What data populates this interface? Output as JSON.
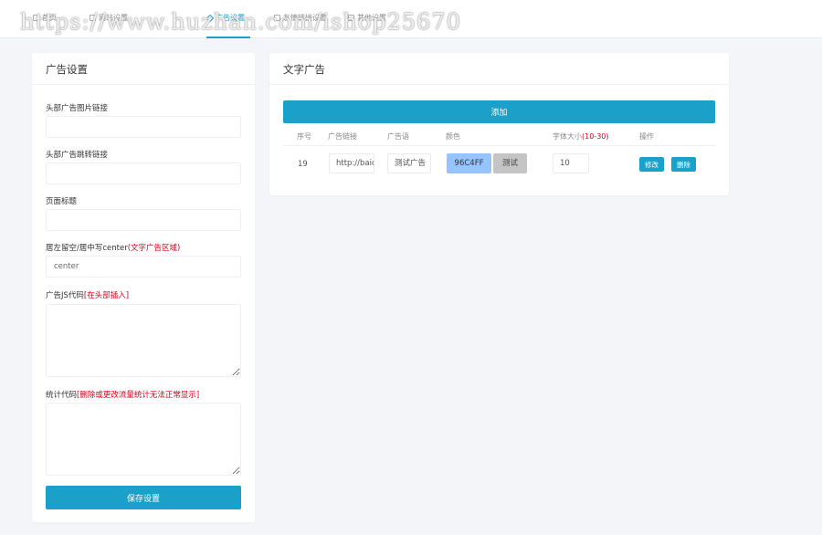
{
  "watermark": "https://www.huzhan.com/ishop25670",
  "nav": {
    "items": [
      {
        "label": "首页"
      },
      {
        "label": "网站设置"
      },
      {
        "label": "广告设置"
      },
      {
        "label": "友情链接设置"
      },
      {
        "label": "其他设置"
      }
    ],
    "active_index": 2
  },
  "ad_settings": {
    "title": "广告设置",
    "header_image_label": "头部广告图片链接",
    "header_image_value": "",
    "header_link_label": "头部广告跳转链接",
    "header_link_value": "",
    "page_title_label": "页面标题",
    "page_title_value": "",
    "align_label": "居左留空/居中写center",
    "align_note": "(文字广告区域)",
    "align_value": "center",
    "js_label": "广告JS代码",
    "js_note": "[在头部插入]",
    "stats_label": "统计代码",
    "stats_note": "[删除或更改流量统计无法正常显示]",
    "save_label": "保存设置"
  },
  "text_ads": {
    "title": "文字广告",
    "add_label": "添加",
    "columns": {
      "id": "序号",
      "link": "广告链接",
      "slogan": "广告语",
      "color": "颜色",
      "font_size": "字体大小",
      "font_size_note": "(10-30)",
      "actions": "操作"
    },
    "rows": [
      {
        "id": "19",
        "link": "http://baidu.com",
        "slogan": "测试广告",
        "color": "96C4FF",
        "color_hex": "#96C4FF",
        "preview": "测试",
        "font_size": "10",
        "edit_label": "修改",
        "delete_label": "删除"
      }
    ]
  },
  "colors": {
    "accent": "#1aa0c9",
    "warning": "#d0021b",
    "background": "#f3f5f8"
  }
}
